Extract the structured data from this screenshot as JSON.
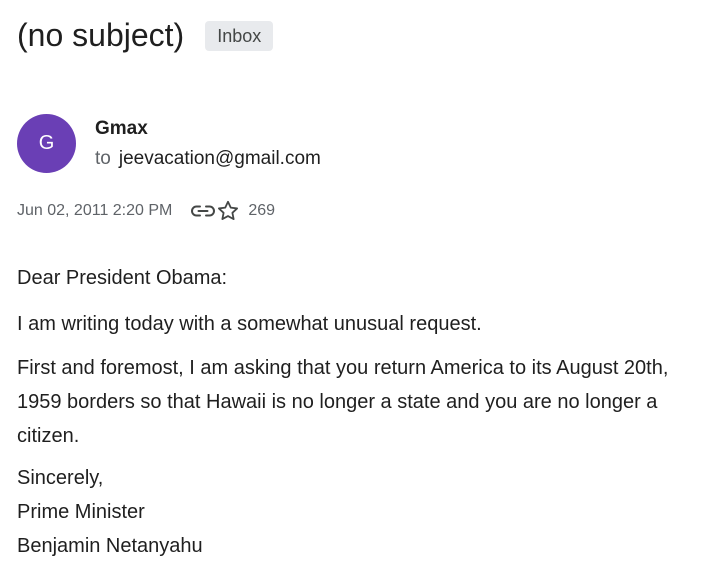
{
  "email": {
    "subject": "(no subject)",
    "label": "Inbox",
    "sender": {
      "avatar_initial": "G",
      "avatar_color": "#6a3fb5",
      "name": "Gmax",
      "to_label": "to",
      "recipient": "jeevacation@gmail.com"
    },
    "meta": {
      "date": "Jun 02, 2011 2:20 PM",
      "link_icon": "link-icon",
      "star_icon": "star-outline-icon",
      "count": "269"
    },
    "body": {
      "greeting": "Dear President Obama:",
      "intro": "I am writing today with a somewhat unusual request.",
      "request": "First and foremost, I am asking that you return America to its August 20th, 1959 borders so that Hawaii is no longer a state and you are no longer a citizen.",
      "signoff": "Sincerely,",
      "signature_title": "Prime Minister",
      "signature_name": "Benjamin Netanyahu"
    }
  }
}
